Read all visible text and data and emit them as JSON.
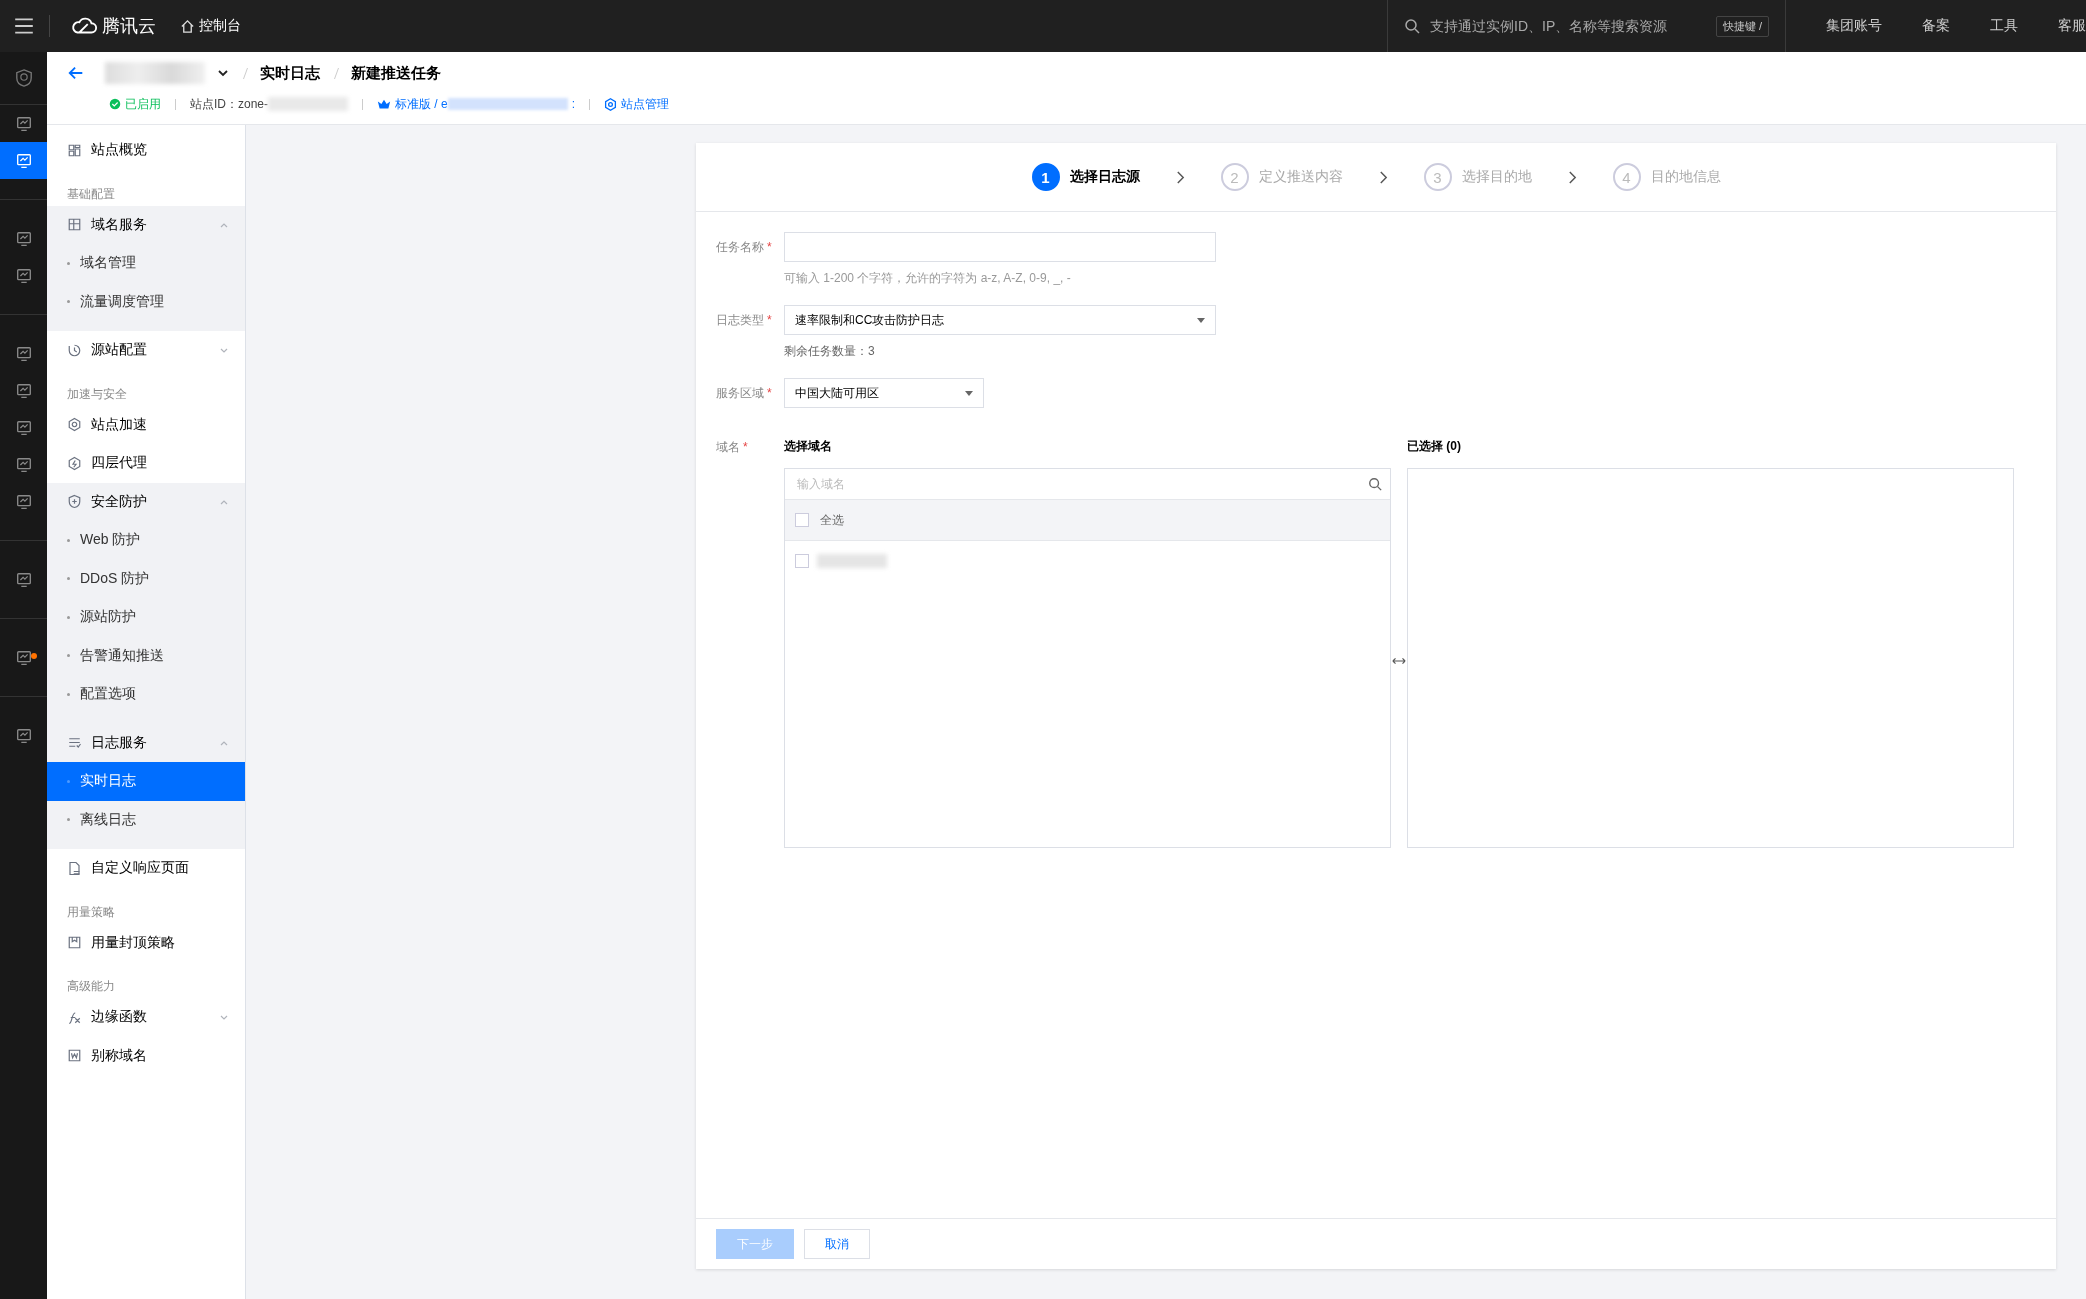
{
  "topbar": {
    "brand": "腾讯云",
    "console": "控制台",
    "search": {
      "placeholder": "支持通过实例ID、IP、名称等搜索资源"
    },
    "shortcut": "快捷键 /",
    "links": [
      "集团账号",
      "备案",
      "工具",
      "客服"
    ]
  },
  "rail": [
    {
      "selected": false,
      "badge": false
    },
    {
      "selected": true,
      "badge": false
    },
    {
      "selected": false,
      "badge": false
    },
    {
      "selected": false,
      "badge": false
    },
    {
      "selected": false,
      "badge": false
    },
    {
      "selected": false,
      "badge": false
    },
    {
      "selected": false,
      "badge": false
    },
    {
      "selected": false,
      "badge": false
    },
    {
      "selected": false,
      "badge": false
    },
    {
      "selected": false,
      "badge": false
    },
    {
      "selected": false,
      "badge": true
    },
    {
      "selected": false,
      "badge": false
    }
  ],
  "header": {
    "breadcrumbs": [
      "实时日志",
      "新建推送任务"
    ],
    "status": {
      "label": "已启用",
      "enabled": true
    },
    "zone_id": "站点ID：zone-",
    "plan": "标准版 / e",
    "plan_tail": ":",
    "manage_link": "站点管理"
  },
  "sidebar": [
    {
      "kind": "item",
      "label": "站点概览",
      "selected": false
    },
    {
      "kind": "section",
      "label": "基础配置"
    },
    {
      "kind": "group",
      "label": "域名服务",
      "expanded": true,
      "children": [
        {
          "label": "域名管理",
          "selected": false
        },
        {
          "label": "流量调度管理",
          "selected": false
        }
      ]
    },
    {
      "kind": "group",
      "label": "源站配置",
      "expanded": false
    },
    {
      "kind": "section",
      "label": "加速与安全"
    },
    {
      "kind": "item",
      "label": "站点加速",
      "selected": false
    },
    {
      "kind": "item",
      "label": "四层代理",
      "selected": false
    },
    {
      "kind": "group",
      "label": "安全防护",
      "expanded": true,
      "children": [
        {
          "label": "Web 防护",
          "selected": false
        },
        {
          "label": "DDoS 防护",
          "selected": false
        },
        {
          "label": "源站防护",
          "selected": false
        },
        {
          "label": "告警通知推送",
          "selected": false
        },
        {
          "label": "配置选项",
          "selected": false
        }
      ]
    },
    {
      "kind": "group",
      "label": "日志服务",
      "expanded": true,
      "children": [
        {
          "label": "实时日志",
          "selected": true
        },
        {
          "label": "离线日志",
          "selected": false
        }
      ]
    },
    {
      "kind": "item",
      "label": "自定义响应页面",
      "selected": false
    },
    {
      "kind": "section",
      "label": "用量策略"
    },
    {
      "kind": "item",
      "label": "用量封顶策略",
      "selected": false
    },
    {
      "kind": "section",
      "label": "高级能力"
    },
    {
      "kind": "group",
      "label": "边缘函数",
      "expanded": false
    },
    {
      "kind": "item",
      "label": "别称域名",
      "selected": false
    }
  ],
  "steps": [
    {
      "number": "1",
      "label": "选择日志源",
      "selected": true
    },
    {
      "number": "2",
      "label": "定义推送内容",
      "selected": false
    },
    {
      "number": "3",
      "label": "选择目的地",
      "selected": false
    },
    {
      "number": "4",
      "label": "目的地信息",
      "selected": false
    }
  ],
  "form": {
    "task_name": {
      "label": "任务名称",
      "required_mark": "*",
      "hint": "可输入 1-200 个字符，允许的字符为 a-z, A-Z, 0-9, _, -"
    },
    "log_type": {
      "label": "日志类型",
      "required_mark": "*",
      "value": "速率限制和CC攻击防护日志",
      "note": "剩余任务数量：3"
    },
    "region": {
      "label": "服务区域",
      "required_mark": "*",
      "value": "中国大陆可用区"
    },
    "domain": {
      "label": "域名",
      "required_mark": "*",
      "source_title": "选择域名",
      "search": {
        "placeholder": "输入域名"
      },
      "select_all": {
        "label": "全选",
        "checked": false
      },
      "items": [
        {
          "checked": false
        }
      ],
      "target_title": "已选择 (0)"
    }
  },
  "footer": {
    "next": {
      "label": "下一步",
      "disabled": true
    },
    "cancel": "取消"
  }
}
